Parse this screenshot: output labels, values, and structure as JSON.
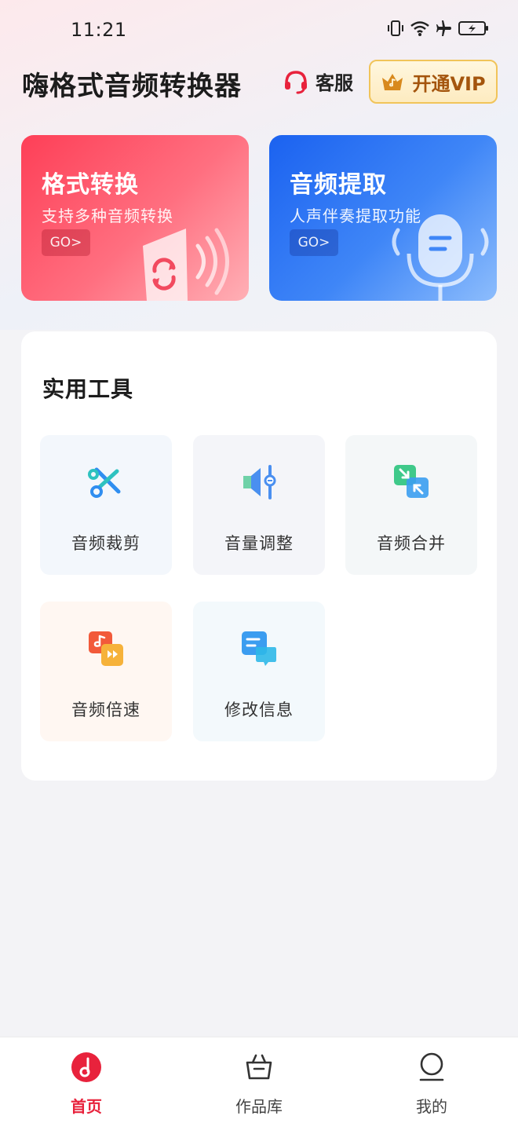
{
  "status_bar": {
    "time": "11:21"
  },
  "header": {
    "title": "嗨格式音频转换器",
    "service_label": "客服",
    "vip_label": "开通VIP"
  },
  "banners": [
    {
      "title": "格式转换",
      "subtitle": "支持多种音频转换",
      "go": "GO>"
    },
    {
      "title": "音频提取",
      "subtitle": "人声伴奏提取功能",
      "go": "GO>"
    }
  ],
  "tools": {
    "title": "实用工具",
    "items": [
      {
        "label": "音频裁剪",
        "icon": "scissors-icon"
      },
      {
        "label": "音量调整",
        "icon": "volume-adjust-icon"
      },
      {
        "label": "音频合并",
        "icon": "merge-icon"
      },
      {
        "label": "音频倍速",
        "icon": "speed-icon"
      },
      {
        "label": "修改信息",
        "icon": "edit-info-icon"
      }
    ]
  },
  "tabbar": {
    "items": [
      {
        "label": "首页",
        "icon": "music-note-icon",
        "active": true
      },
      {
        "label": "作品库",
        "icon": "basket-icon",
        "active": false
      },
      {
        "label": "我的",
        "icon": "user-icon",
        "active": false
      }
    ]
  },
  "colors": {
    "accent_red": "#e8223c",
    "blue": "#1b62f0",
    "vip_gold": "#a4550d"
  }
}
